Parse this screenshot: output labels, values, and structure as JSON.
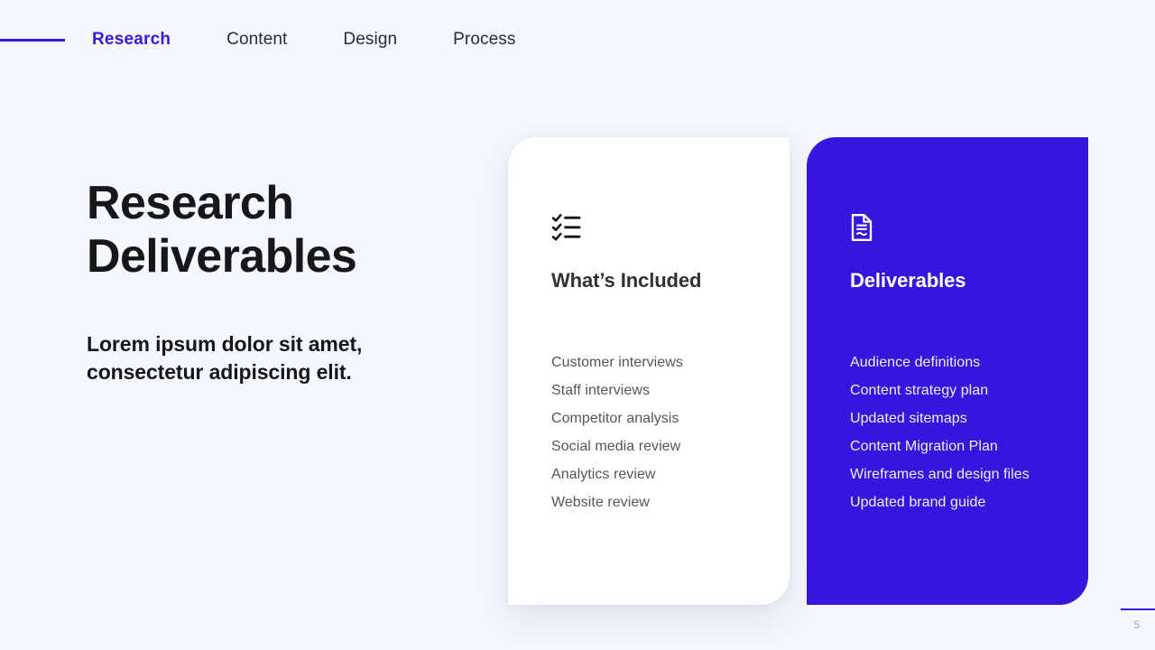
{
  "nav": {
    "items": [
      {
        "label": "Research",
        "active": true
      },
      {
        "label": "Content",
        "active": false
      },
      {
        "label": "Design",
        "active": false
      },
      {
        "label": "Process",
        "active": false
      }
    ]
  },
  "hero": {
    "title": "Research\nDeliverables",
    "subtitle": "Lorem ipsum dolor sit amet,\nconsectetur adipiscing elit."
  },
  "cards": [
    {
      "icon": "checklist-icon",
      "title": "What’s Included",
      "items": [
        "Customer interviews",
        "Staff interviews",
        "Competitor analysis",
        "Social media review",
        "Analytics review",
        "Website review"
      ]
    },
    {
      "icon": "document-icon",
      "title": "Deliverables",
      "items": [
        "Audience definitions",
        "Content strategy plan",
        "Updated sitemaps",
        "Content Migration Plan",
        "Wireframes and design files",
        "Updated brand guide"
      ]
    }
  ],
  "footer": {
    "page_number": "5"
  },
  "colors": {
    "accent": "#3715DE",
    "background": "#F4F7FD",
    "heading": "#17171B",
    "body_text": "#55555D"
  }
}
